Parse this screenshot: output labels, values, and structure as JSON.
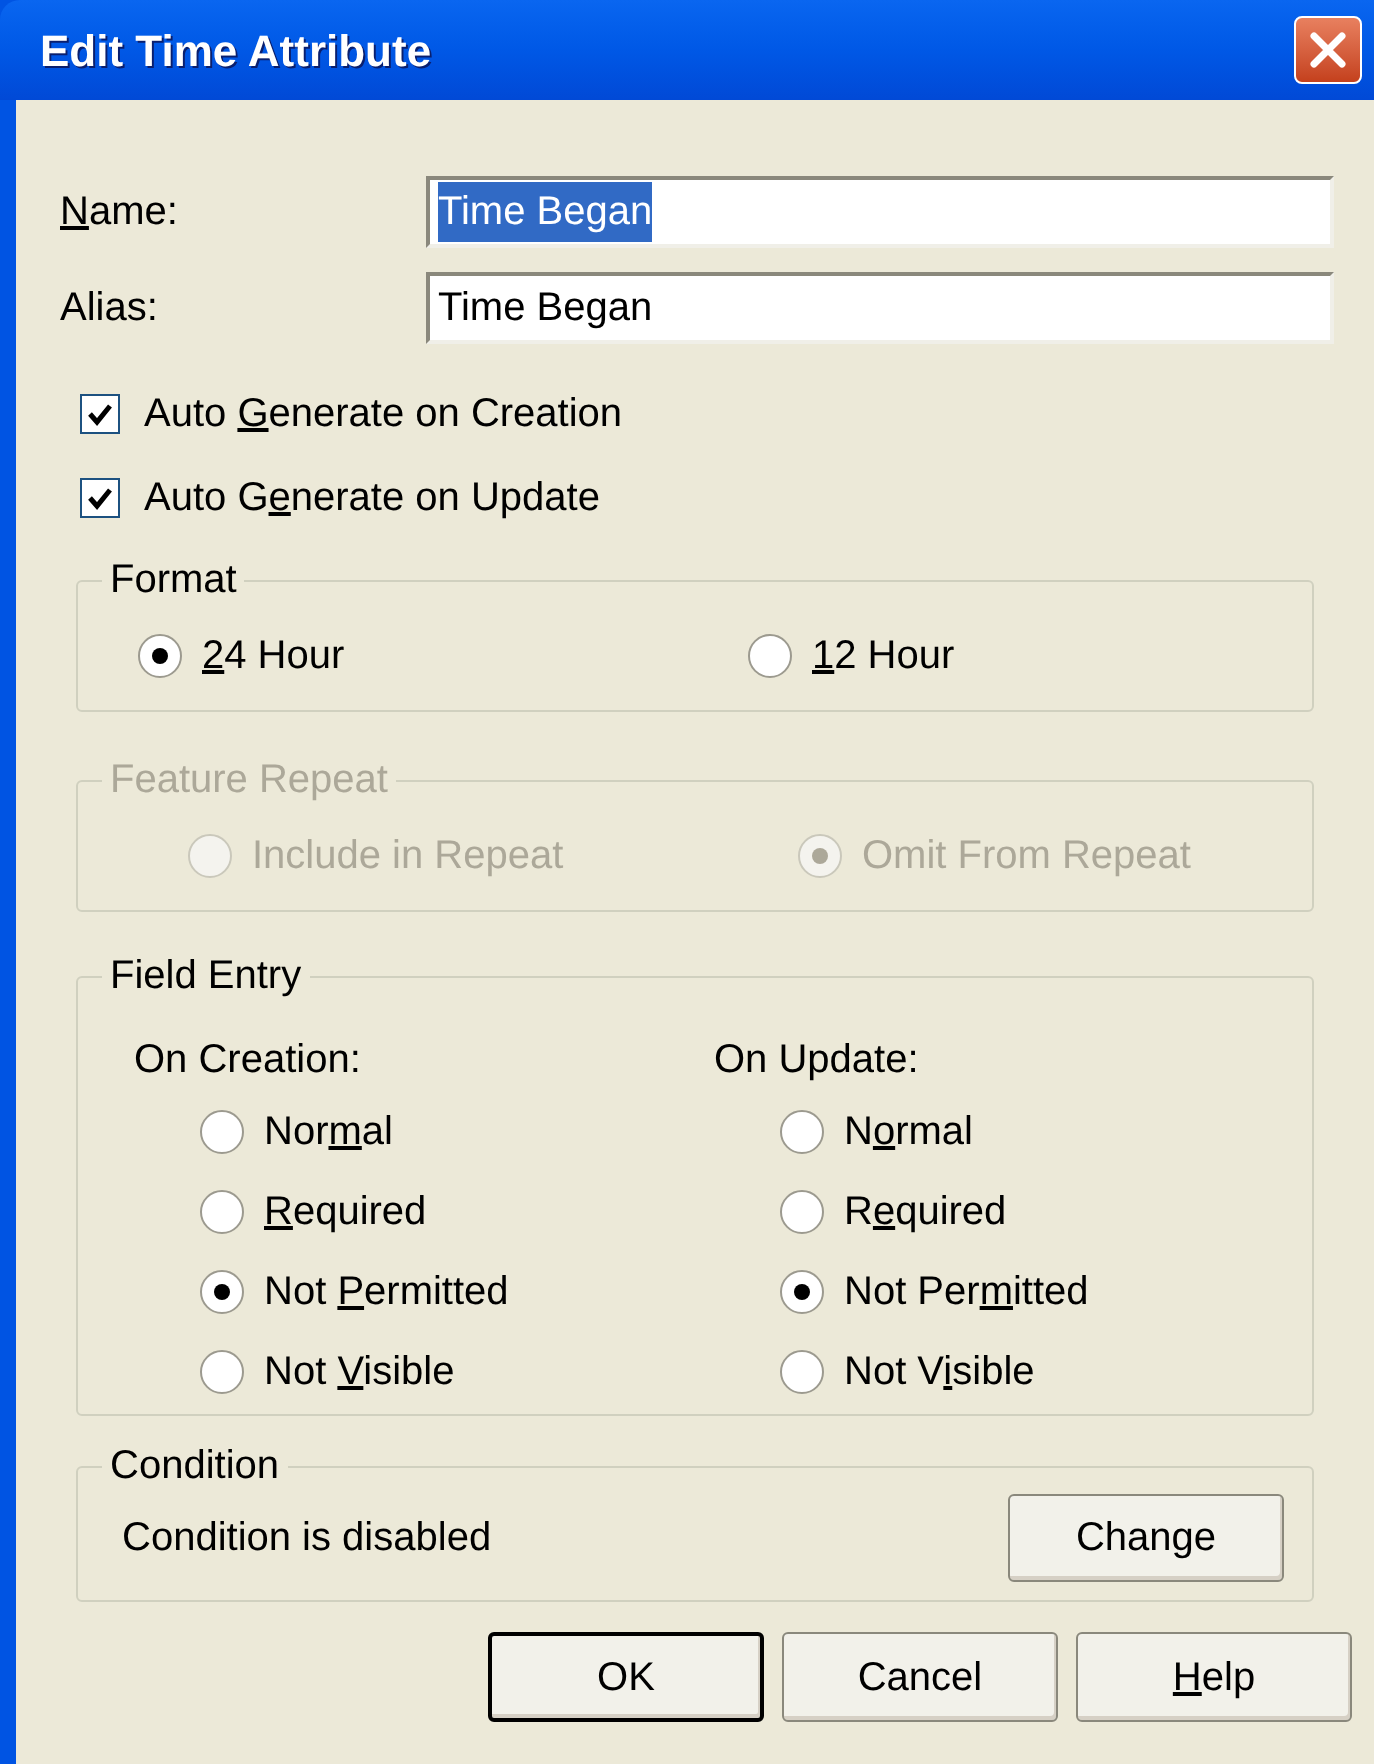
{
  "window": {
    "title": "Edit Time Attribute"
  },
  "fields": [
    {
      "label": {
        "key": "N",
        "post": "ame:"
      },
      "value": "Time Began",
      "selected": true
    },
    {
      "label": {
        "pre": "Alias:"
      },
      "value": "Time Began",
      "selected": false
    }
  ],
  "checkboxes": [
    {
      "label": {
        "pre": "Auto ",
        "key": "G",
        "post": "enerate on Creation"
      },
      "checked": true
    },
    {
      "label": {
        "pre": "Auto G",
        "key": "e",
        "post": "nerate on Update"
      },
      "checked": true
    }
  ],
  "format": {
    "title": "Format",
    "disabled": false,
    "options": [
      {
        "label": {
          "key": "2",
          "post": "4 Hour"
        },
        "selected": true
      },
      {
        "label": {
          "key": "1",
          "post": "2 Hour"
        },
        "selected": false
      }
    ]
  },
  "feature_repeat": {
    "title": "Feature Repeat",
    "disabled": true,
    "options": [
      {
        "label": {
          "pre": "Include in Repeat"
        },
        "selected": false
      },
      {
        "label": {
          "pre": "Omit From Repeat"
        },
        "selected": true
      }
    ]
  },
  "field_entry": {
    "title": "Field Entry",
    "columns": [
      {
        "heading": "On Creation:",
        "options": [
          {
            "label": {
              "pre": "Nor",
              "key": "m",
              "post": "al"
            },
            "selected": false
          },
          {
            "label": {
              "key": "R",
              "post": "equired"
            },
            "selected": false
          },
          {
            "label": {
              "pre": "Not ",
              "key": "P",
              "post": "ermitted"
            },
            "selected": true
          },
          {
            "label": {
              "pre": "Not ",
              "key": "V",
              "post": "isible"
            },
            "selected": false
          }
        ]
      },
      {
        "heading": "On Update:",
        "options": [
          {
            "label": {
              "pre": "N",
              "key": "o",
              "post": "rmal"
            },
            "selected": false
          },
          {
            "label": {
              "pre": "R",
              "key": "e",
              "post": "quired"
            },
            "selected": false
          },
          {
            "label": {
              "pre": "Not Per",
              "key": "m",
              "post": "itted"
            },
            "selected": true
          },
          {
            "label": {
              "pre": "Not V",
              "key": "i",
              "post": "sible"
            },
            "selected": false
          }
        ]
      }
    ]
  },
  "condition": {
    "title": "Condition",
    "text": "Condition is disabled",
    "button": {
      "label": {
        "pre": "Change"
      }
    }
  },
  "buttons": [
    {
      "label": {
        "pre": "OK"
      },
      "default": true
    },
    {
      "label": {
        "pre": "Cancel"
      },
      "default": false
    },
    {
      "label": {
        "key": "H",
        "post": "elp"
      },
      "default": false
    }
  ]
}
